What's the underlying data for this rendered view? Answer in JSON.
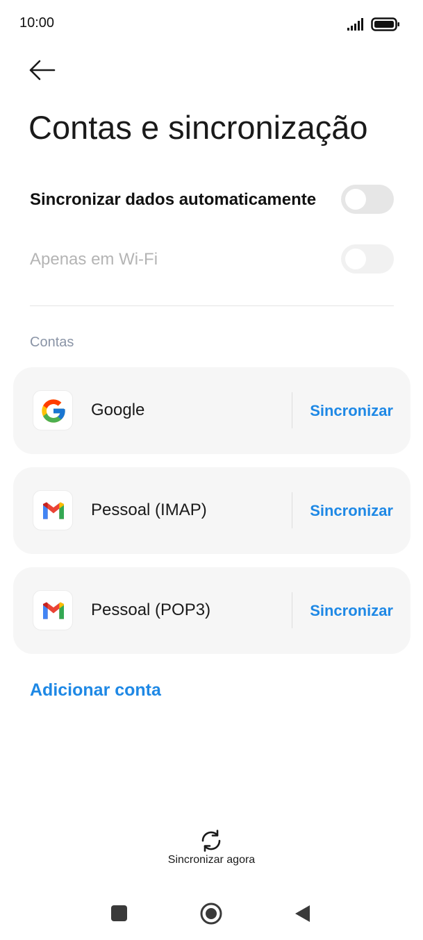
{
  "status_bar": {
    "time": "10:00",
    "signal_icon": "signal-icon",
    "battery_icon": "battery-icon"
  },
  "header": {
    "back_icon": "arrow-left-icon",
    "title": "Contas e sincronização"
  },
  "settings": {
    "auto_sync": {
      "label": "Sincronizar dados automaticamente",
      "enabled": false
    },
    "wifi_only": {
      "label": "Apenas em Wi-Fi",
      "enabled": false,
      "disabled": true
    }
  },
  "accounts_section": {
    "header": "Contas",
    "accounts": [
      {
        "name": "Google",
        "icon": "google-icon",
        "action": "Sincronizar"
      },
      {
        "name": "Pessoal (IMAP)",
        "icon": "gmail-icon",
        "action": "Sincronizar"
      },
      {
        "name": "Pessoal (POP3)",
        "icon": "gmail-icon",
        "action": "Sincronizar"
      }
    ],
    "add_account": "Adicionar conta"
  },
  "sync_now": {
    "icon": "sync-icon",
    "label": "Sincronizar agora"
  },
  "nav_bar": {
    "recents_icon": "square-icon",
    "home_icon": "circle-home-icon",
    "back_icon": "triangle-back-icon"
  },
  "colors": {
    "accent": "#1e88e5",
    "card_background": "#f6f6f6",
    "toggle_off": "#e6e6e6",
    "disabled_text": "#b4b4b4",
    "section_header": "#8a94a6"
  }
}
